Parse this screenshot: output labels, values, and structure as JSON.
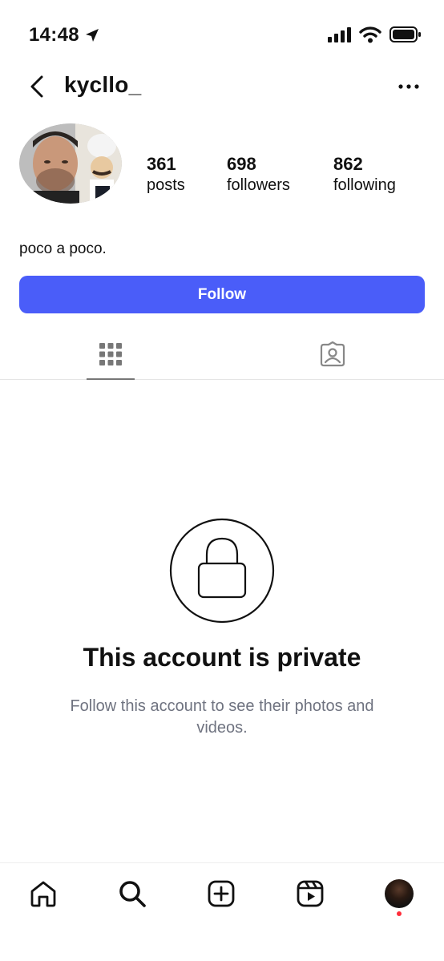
{
  "status_bar": {
    "time": "14:48",
    "icons": [
      "location-arrow-icon",
      "signal-icon",
      "wifi-icon",
      "battery-icon"
    ]
  },
  "header": {
    "username": "kycllo_",
    "back_icon": "chevron-left-icon",
    "more_icon": "ellipsis-icon"
  },
  "profile": {
    "stats": [
      {
        "value": "361",
        "label": "posts"
      },
      {
        "value": "698",
        "label": "followers"
      },
      {
        "value": "862",
        "label": "following"
      }
    ],
    "bio": "poco a poco.",
    "follow_label": "Follow"
  },
  "tabs": [
    {
      "name": "grid",
      "icon": "grid-icon",
      "active": true
    },
    {
      "name": "tagged",
      "icon": "tagged-person-icon",
      "active": false
    }
  ],
  "private": {
    "title": "This account is private",
    "subtitle": "Follow this account to see their photos and videos."
  },
  "bottom_nav": {
    "items": [
      "home-icon",
      "search-icon",
      "create-icon",
      "reels-icon",
      "profile-avatar"
    ]
  },
  "colors": {
    "accent": "#4a5df9",
    "subtext": "#6f7380",
    "notification": "#ff2d3a"
  }
}
